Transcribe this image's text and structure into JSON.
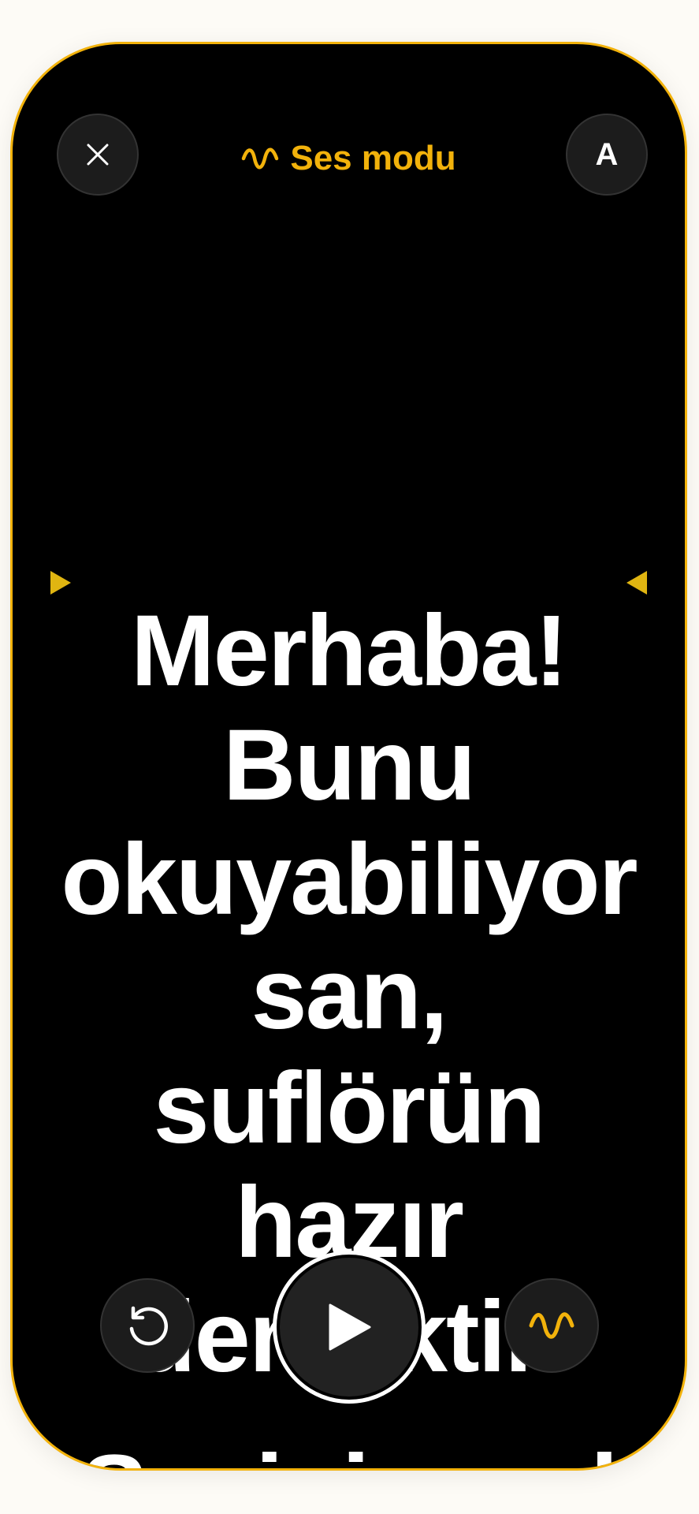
{
  "header": {
    "mode_label": "Ses modu",
    "font_button_label": "A"
  },
  "script": {
    "current_text": "Merhaba! Bunu okuyabiliyorsan, suflörün hazır demektir.",
    "next_text": "Sesini nasıl"
  },
  "icons": {
    "close": "close-icon",
    "waveform": "waveform-icon",
    "font": "font-size-icon",
    "reset": "restart-icon",
    "play": "play-icon",
    "voice": "waveform-icon",
    "markers": "reading-line-marker-icon"
  },
  "colors": {
    "accent": "#f2b20b",
    "background": "#000000",
    "text": "#ffffff",
    "button": "#1c1c1c"
  }
}
